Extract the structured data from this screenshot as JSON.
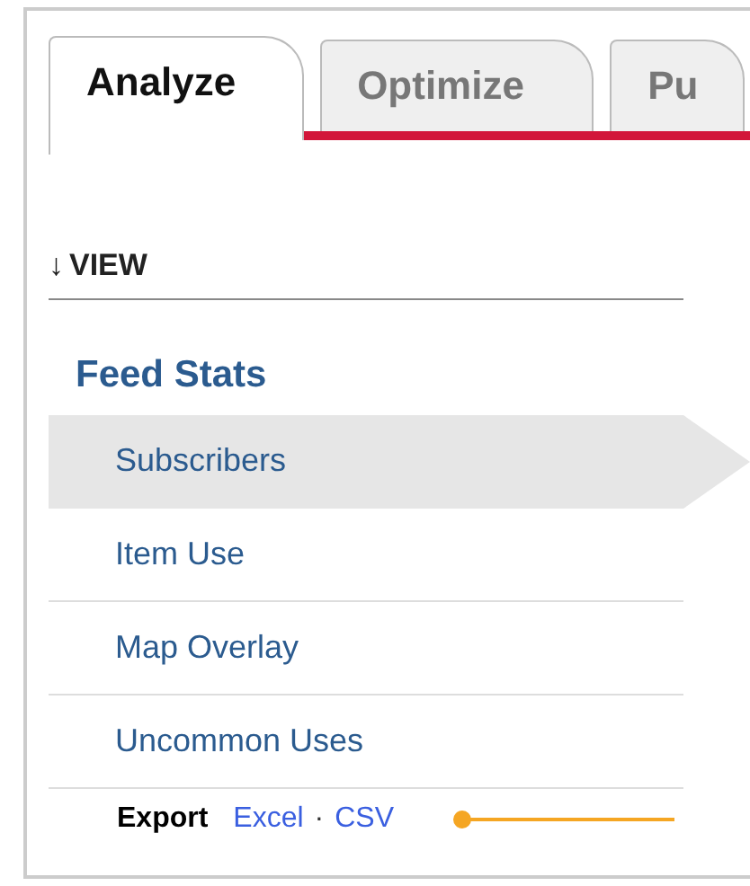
{
  "tabs": [
    {
      "label": "Analyze",
      "selected": true
    },
    {
      "label": "Optimize",
      "selected": false
    },
    {
      "label": "Pu",
      "selected": false
    }
  ],
  "view_toggle": {
    "arrow": "↓",
    "label": "VIEW"
  },
  "section": {
    "title": "Feed Stats"
  },
  "nav_items": [
    {
      "label": "Subscribers",
      "selected": true
    },
    {
      "label": "Item Use",
      "selected": false
    },
    {
      "label": "Map Overlay",
      "selected": false
    },
    {
      "label": "Uncommon Uses",
      "selected": false
    }
  ],
  "export": {
    "label": "Export",
    "links": [
      "Excel",
      "CSV"
    ],
    "separator": "·"
  }
}
